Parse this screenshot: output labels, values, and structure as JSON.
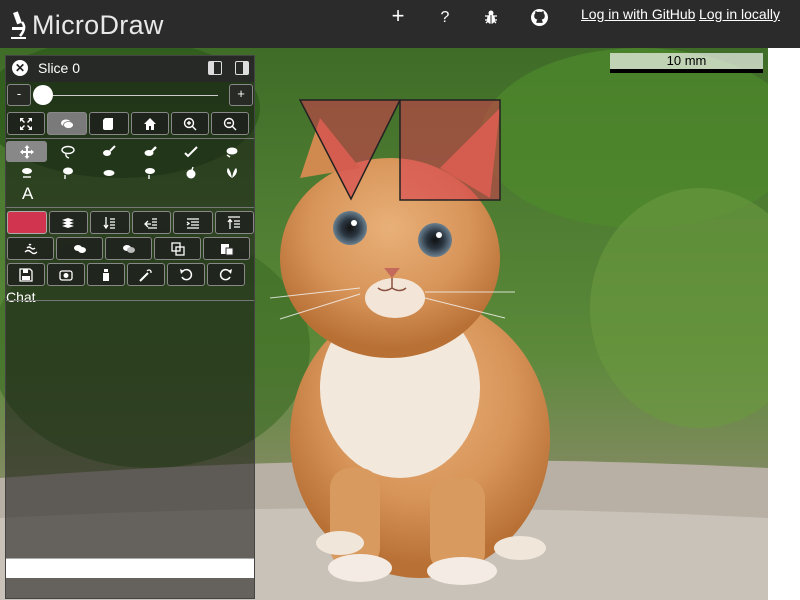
{
  "app": {
    "title": "MicroDraw"
  },
  "topbar": {
    "add_label": "+",
    "help_label": "?",
    "login_github": "Log in with GitHub",
    "login_local": "Log in locally"
  },
  "scalebar": {
    "label": "10 mm"
  },
  "panel": {
    "slice_title": "Slice 0",
    "slider": {
      "minus": "-",
      "plus": "+",
      "value": 0
    },
    "letter_tool": "A",
    "chat_label": "Chat",
    "brush_color": "#d0344e"
  },
  "icons": [
    "logo-microscope-icon",
    "plus-icon",
    "help-icon",
    "bug-icon",
    "github-icon",
    "close-icon",
    "dock-left-icon",
    "dock-right-icon",
    "fullscreen-icon",
    "chat-icon",
    "scroll-icon",
    "home-icon",
    "zoom-in-icon",
    "zoom-out-icon",
    "move-icon",
    "lasso-icon",
    "pencil-icon",
    "eraser-icon",
    "select-icon",
    "text-icon",
    "layers-icon",
    "save-icon",
    "undo-icon",
    "redo-icon"
  ]
}
